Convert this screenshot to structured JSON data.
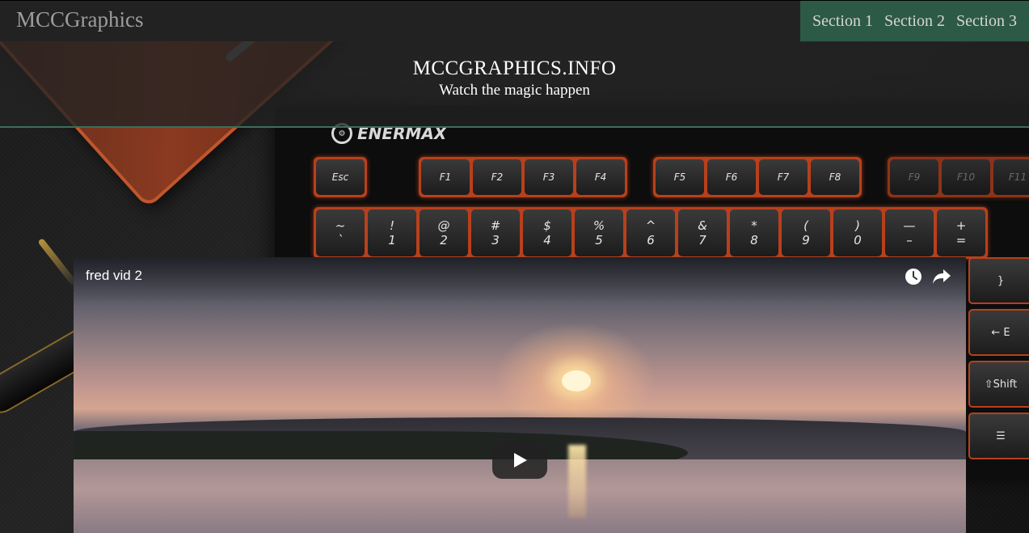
{
  "navbar": {
    "brand": "MCCGraphics",
    "links": [
      "Section 1",
      "Section 2",
      "Section 3"
    ]
  },
  "header": {
    "title": "MCCGRAPHICS.INFO",
    "tagline": "Watch the magic happen"
  },
  "background": {
    "keyboard_brand": "ENERMAX",
    "function_keys": [
      "Esc",
      "F1",
      "F2",
      "F3",
      "F4",
      "F5",
      "F6",
      "F7",
      "F8",
      "F9",
      "F10",
      "F11"
    ],
    "number_keys": [
      {
        "top": "~",
        "bottom": "`"
      },
      {
        "top": "!",
        "bottom": "1"
      },
      {
        "top": "@",
        "bottom": "2"
      },
      {
        "top": "#",
        "bottom": "3"
      },
      {
        "top": "$",
        "bottom": "4"
      },
      {
        "top": "%",
        "bottom": "5"
      },
      {
        "top": "^",
        "bottom": "6"
      },
      {
        "top": "&",
        "bottom": "7"
      },
      {
        "top": "*",
        "bottom": "8"
      },
      {
        "top": "(",
        "bottom": "9"
      },
      {
        "top": ")",
        "bottom": "0"
      },
      {
        "top": "—",
        "bottom": "–"
      },
      {
        "top": "+",
        "bottom": "="
      }
    ],
    "side_keys": [
      "}",
      "← E",
      "⇧Shift",
      "☰"
    ]
  },
  "video": {
    "title": "fred vid 2"
  },
  "colors": {
    "navbar_bg": "#222222",
    "nav_menu_bg": "#2d5947",
    "header_border": "#3d6e58",
    "keyboard_glow": "#b8401c"
  },
  "icons": {
    "watch_later": "clock-icon",
    "share": "share-arrow-icon",
    "play": "play-icon"
  }
}
